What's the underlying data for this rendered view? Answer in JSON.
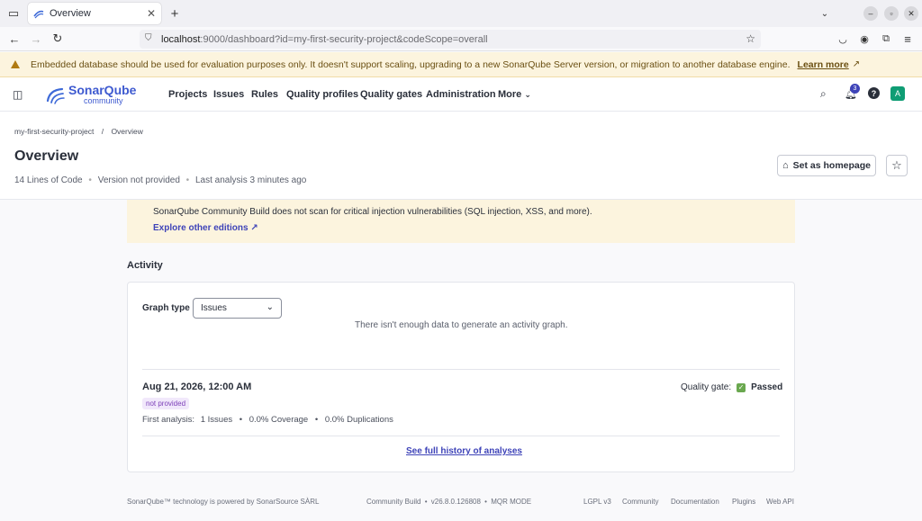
{
  "browser": {
    "tab_title": "Overview",
    "url_host": "localhost",
    "url_rest": ":9000/dashboard?id=my-first-security-project&codeScope=overall"
  },
  "warning": {
    "text": "Embedded database should be used for evaluation purposes only. It doesn't support scaling, upgrading to a new SonarQube Server version, or migration to another database engine.",
    "link": "Learn more"
  },
  "header": {
    "logo_main": "SonarQube",
    "logo_sub": "community",
    "nav": [
      "Projects",
      "Issues",
      "Rules",
      "Quality profiles",
      "Quality gates",
      "Administration",
      "More"
    ],
    "notif_count": "3",
    "avatar_letter": "A"
  },
  "project": {
    "breadcrumb_project": "my-first-security-project",
    "breadcrumb_sep": "/",
    "breadcrumb_current": "Overview",
    "title": "Overview",
    "loc": "14 Lines of Code",
    "version": "Version not provided",
    "last_analysis": "Last analysis 3 minutes ago",
    "homepage_btn": "Set as homepage"
  },
  "info": {
    "text": "SonarQube Community Build does not scan for critical injection vulnerabilities (SQL injection, XSS, and more).",
    "link": "Explore other editions"
  },
  "activity": {
    "heading": "Activity",
    "graph_type_label": "Graph type",
    "graph_type_value": "Issues",
    "empty_msg": "There isn't enough data to generate an activity graph.",
    "analysis_date": "Aug 21, 2026, 12:00 AM",
    "version_badge": "not provided",
    "qg_label": "Quality gate:",
    "qg_status": "Passed",
    "first_analysis": "First analysis:",
    "issues": "1 Issues",
    "coverage": "0.0% Coverage",
    "duplications": "0.0% Duplications",
    "history_link": "See full history of analyses"
  },
  "footer": {
    "powered": "SonarQube™ technology is powered by SonarSource SÀRL",
    "build": "Community Build",
    "version": "v26.8.0.126808",
    "mqr": "MQR MODE",
    "links": [
      "LGPL v3",
      "Community",
      "Documentation",
      "Plugins",
      "Web API"
    ]
  },
  "colors": {
    "accent": "#3e43b8",
    "passed": "#6aa84f",
    "avatar": "#0f9d74"
  }
}
